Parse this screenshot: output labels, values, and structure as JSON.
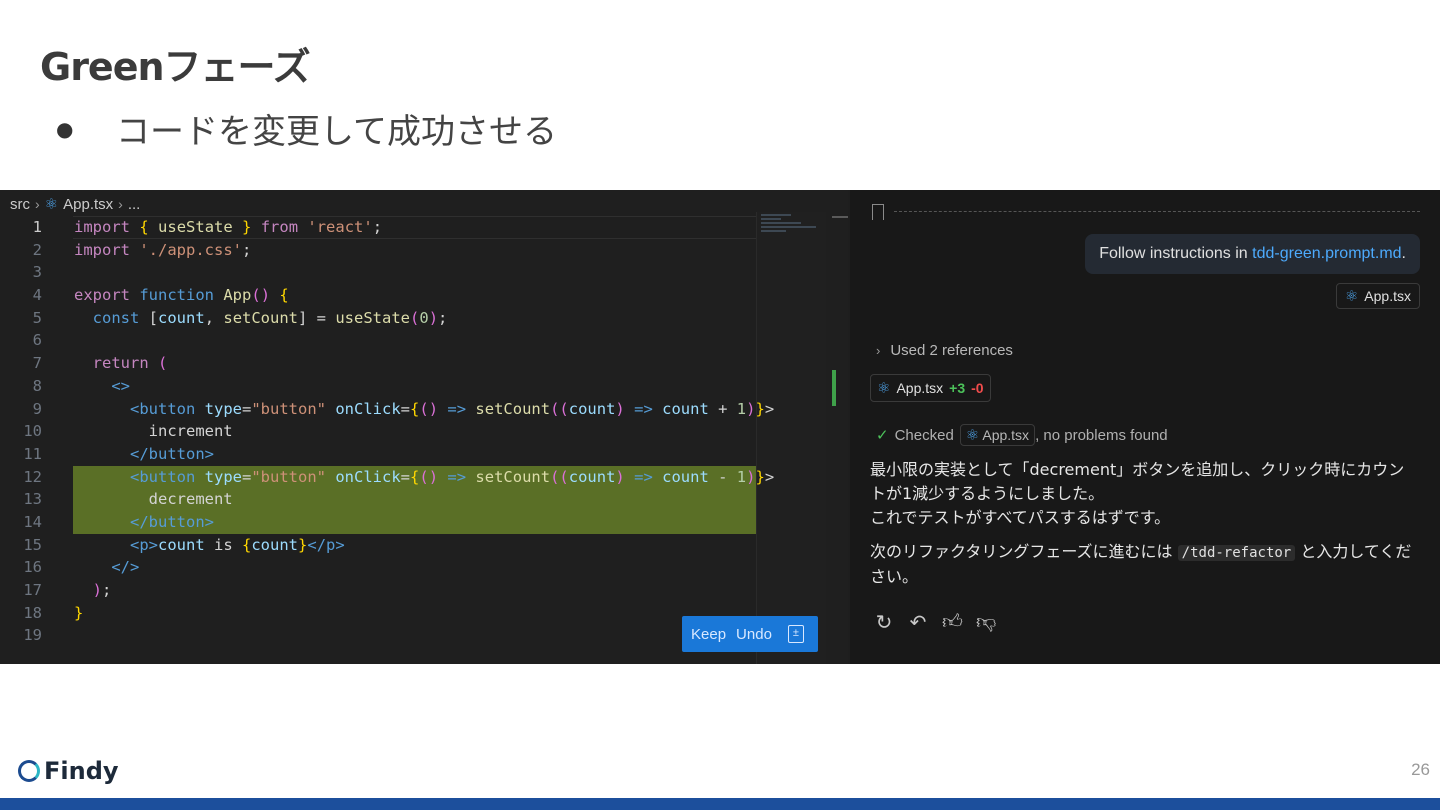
{
  "slide": {
    "title": "Greenフェーズ",
    "bullet": "コードを変更して成功させる",
    "bullet_symbol": "●",
    "page_number": "26",
    "brand": "Findy"
  },
  "editor": {
    "breadcrumb": {
      "folder": "src",
      "file": "App.tsx",
      "more": "..."
    },
    "active_line": 1,
    "highlighted_lines": [
      12,
      13,
      14
    ],
    "line_numbers": [
      "1",
      "2",
      "3",
      "4",
      "5",
      "6",
      "7",
      "8",
      "9",
      "10",
      "11",
      "12",
      "13",
      "14",
      "15",
      "16",
      "17",
      "18",
      "19"
    ],
    "lines": [
      "import { useState } from 'react';",
      "import './app.css';",
      "",
      "export function App() {",
      "  const [count, setCount] = useState(0);",
      "",
      "  return (",
      "    <>",
      "      <button type=\"button\" onClick={() => setCount((count) => count + 1)}>",
      "        increment",
      "      </button>",
      "      <button type=\"button\" onClick={() => setCount((count) => count - 1)}>",
      "        decrement",
      "      </button>",
      "      <p>count is {count}</p>",
      "    </>",
      "  );",
      "}",
      ""
    ],
    "keep_label": "Keep",
    "undo_label": "Undo",
    "diff_icon": "±"
  },
  "chat": {
    "user_message_prefix": "Follow instructions in ",
    "user_message_link": "tdd-green.prompt.md",
    "user_message_suffix": ".",
    "attached_file": "App.tsx",
    "references_label": "Used 2 references",
    "changed_file": "App.tsx",
    "added": "+3",
    "removed": "-0",
    "checked_prefix": "Checked",
    "checked_file": "App.tsx",
    "checked_suffix": ", no problems found",
    "response_p1": "最小限の実装として「decrement」ボタンを追加し、クリック時にカウントが1減少するようにしました。",
    "response_p2": "これでテストがすべてパスするはずです。",
    "response_p3_prefix": "次のリファクタリングフェーズに進むには ",
    "response_p3_code": "/tdd-refactor",
    "response_p3_suffix": " と入力してください。",
    "actions": [
      "retry-icon",
      "undo-icon",
      "thumbs-up-icon",
      "thumbs-down-icon"
    ]
  },
  "colors": {
    "accent_blue": "#1a78d8",
    "highlight_green": "#5a6f26",
    "footer_bar": "#1c4f9c"
  }
}
